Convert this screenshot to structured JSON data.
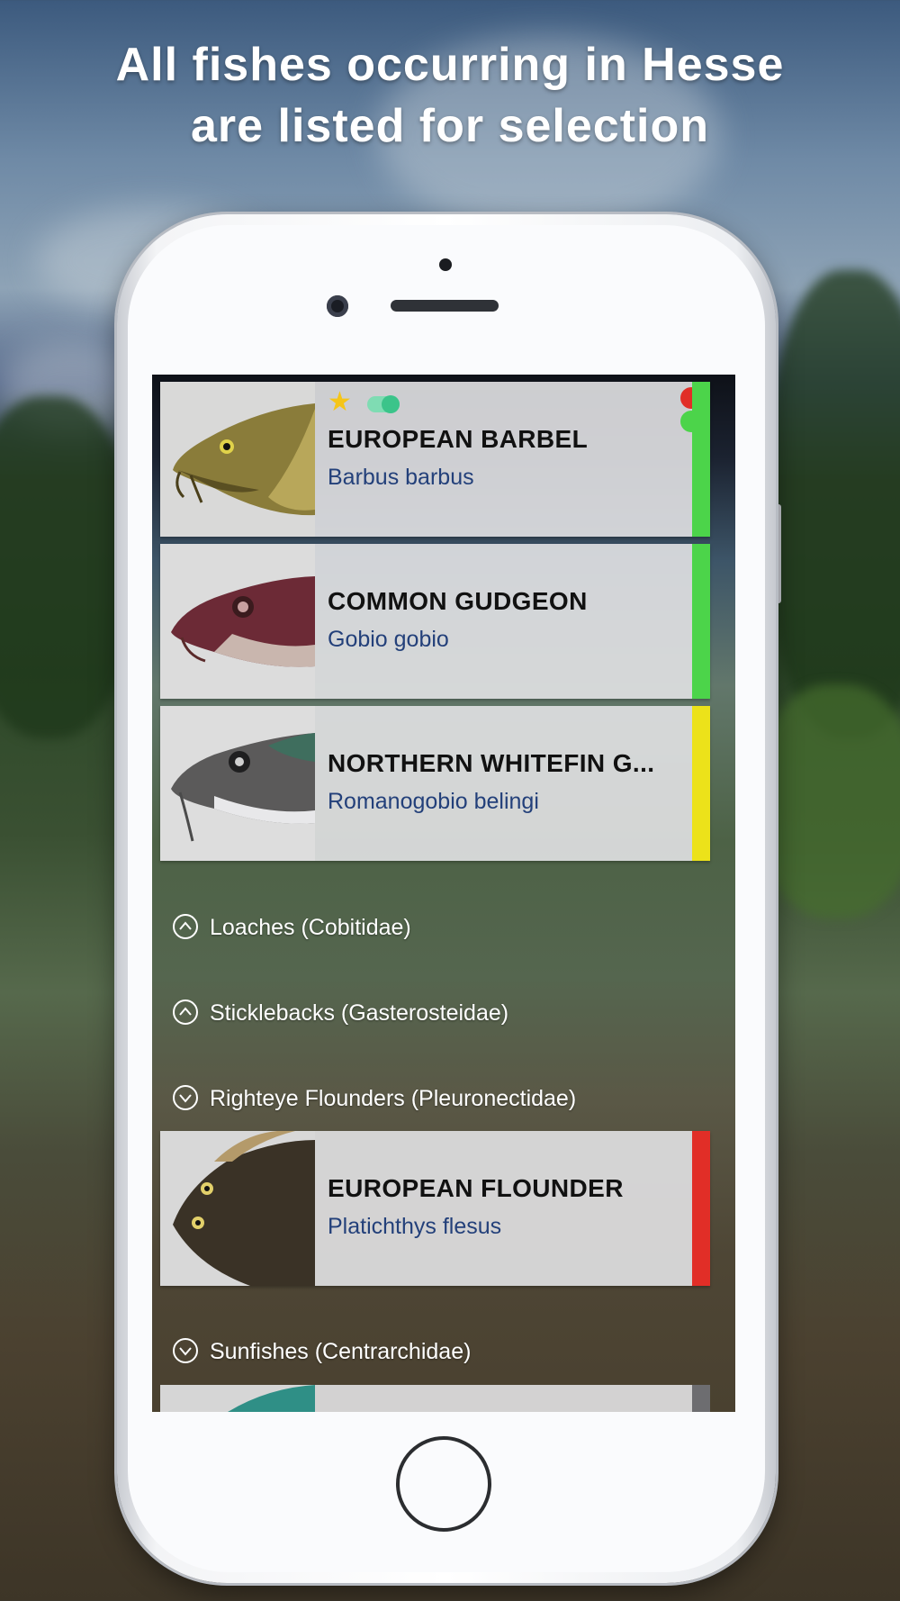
{
  "headline": {
    "line1": "All fishes occurring in Hesse",
    "line2": "are listed for selection"
  },
  "colors": {
    "status_green": "#4cd44a",
    "status_yellow": "#ece21a",
    "status_red": "#e12e27",
    "latin_name": "#23407a",
    "favorite_star": "#f5c518",
    "toggle": "#3bc48a"
  },
  "fish_list": {
    "cards": [
      {
        "common_name": "EUROPEAN BARBEL",
        "latin_name": "Barbus barbus",
        "icons": [
          "star-icon",
          "toggle-icon",
          "red-dot-icon",
          "green-dot-icon"
        ],
        "status_color": "#4cd44a"
      },
      {
        "common_name": "COMMON GUDGEON",
        "latin_name": "Gobio gobio",
        "status_color": "#4cd44a"
      },
      {
        "common_name": "NORTHERN WHITEFIN G...",
        "latin_name": "Romanogobio belingi",
        "status_color": "#ece21a"
      },
      {
        "common_name": "EUROPEAN FLOUNDER",
        "latin_name": "Platichthys flesus",
        "status_color": "#e12e27"
      }
    ],
    "families": [
      {
        "label": "Loaches (Cobitidae)",
        "icon": "chevron-up-icon"
      },
      {
        "label": "Sticklebacks (Gasterosteidae)",
        "icon": "chevron-up-icon"
      },
      {
        "label": "Righteye Flounders (Pleuronectidae)",
        "icon": "chevron-down-icon"
      },
      {
        "label": "Sunfishes (Centrarchidae)",
        "icon": "chevron-down-icon"
      }
    ]
  }
}
